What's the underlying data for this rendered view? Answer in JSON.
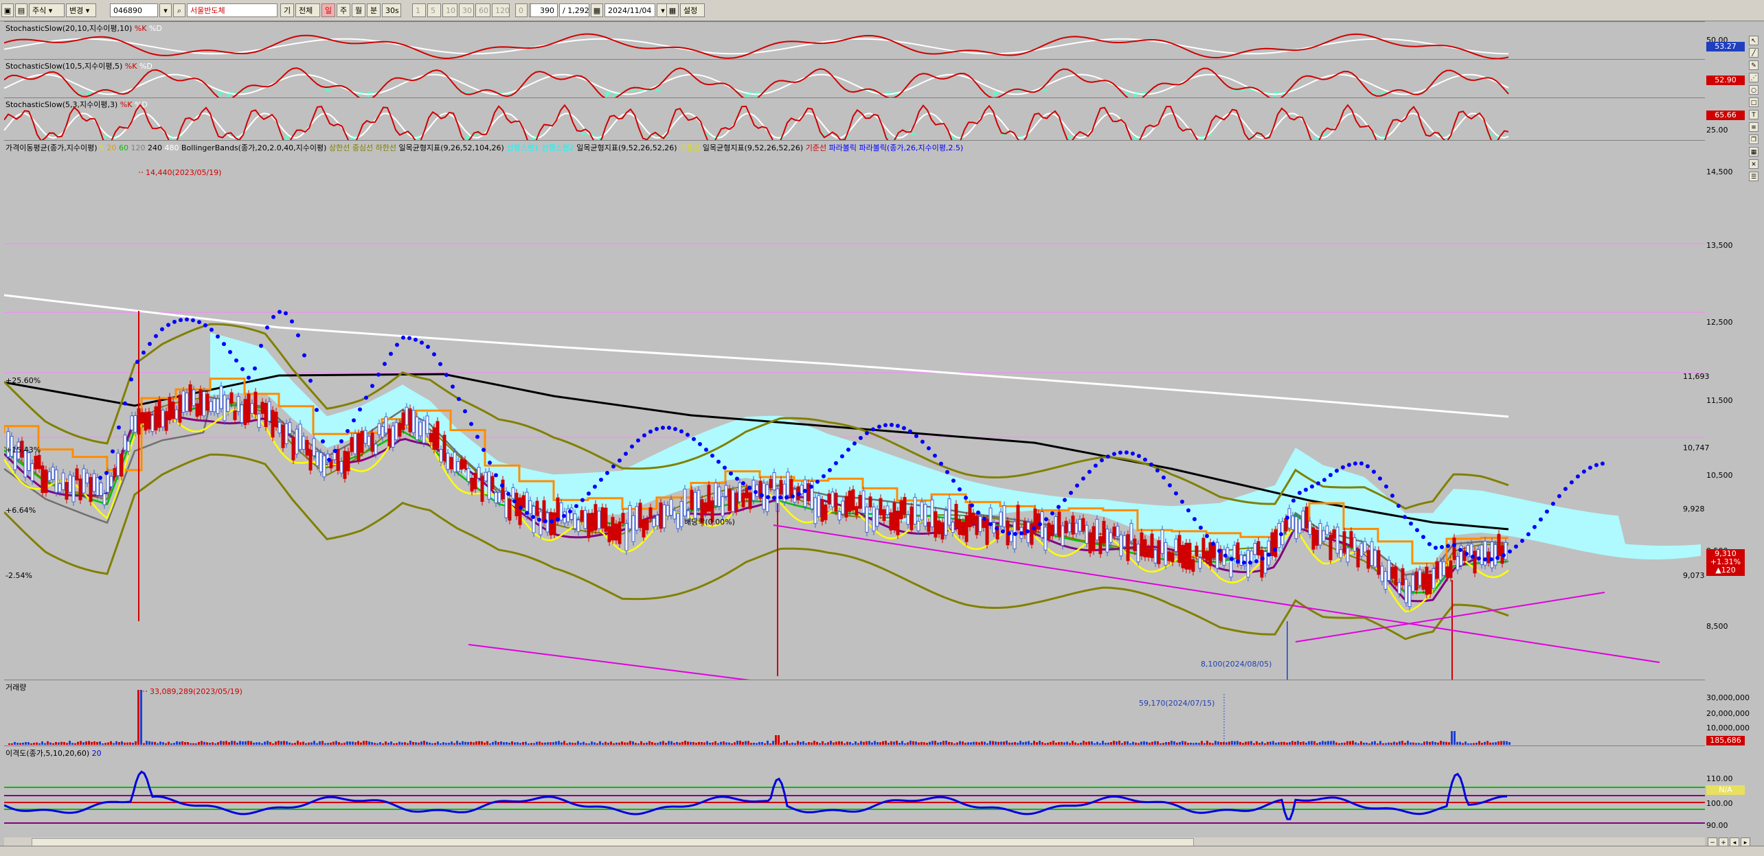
{
  "toolbar": {
    "market_type": "주식",
    "change_label": "변경",
    "code": "046890",
    "stock_name": "서울반도체",
    "period_label": "기",
    "all_label": "전체",
    "d_label": "일",
    "w_label": "주",
    "m_label": "월",
    "min_label": "분",
    "sec_label": "30s",
    "tick_buttons": [
      "1",
      "5",
      "10",
      "30",
      "60",
      "120"
    ],
    "zero_a": "0",
    "zero_b": "0",
    "count_value": "390",
    "total_value": "/ 1,292",
    "date_value": "2024/11/04",
    "settings_label": "설정"
  },
  "panels": {
    "stoch1": {
      "label": "StochasticSlow(20,10,지수이평,10)",
      "legend_k": "%K",
      "legend_d": "%D",
      "scale_top": "50.00",
      "tag": "53.27",
      "tag_color": "#1f3fbf"
    },
    "stoch2": {
      "label": "StochasticSlow(10,5,지수이평,5)",
      "legend_k": "%K",
      "legend_d": "%D",
      "tag": "52.90",
      "tag_color": "#d00000"
    },
    "stoch3": {
      "label": "StochasticSlow(5,3,지수이평,3)",
      "legend_k": "%K",
      "legend_d": "%D",
      "tag": "65.66",
      "tag_color": "#d00000",
      "scale_bottom": "25.00"
    },
    "price": {
      "legend": [
        {
          "text": "가격이동평균(종가,지수이평)",
          "color": "#000000"
        },
        {
          "text": "5",
          "color": "#e0e000"
        },
        {
          "text": "20",
          "color": "#e0a000"
        },
        {
          "text": "60",
          "color": "#00c000"
        },
        {
          "text": "120",
          "color": "#808080"
        },
        {
          "text": "240",
          "color": "#000000"
        },
        {
          "text": "480",
          "color": "#ffffff"
        },
        {
          "text": "BollingerBands(종가,20,2.0,40,지수이평)",
          "color": "#000000"
        },
        {
          "text": "상한선",
          "color": "#808000"
        },
        {
          "text": "중심선",
          "color": "#808000"
        },
        {
          "text": "하한선",
          "color": "#808000"
        },
        {
          "text": "일목균형지표(9,26,52,104,26)",
          "color": "#000000"
        },
        {
          "text": "선행스팬1",
          "color": "#00ffff"
        },
        {
          "text": "선행스팬2",
          "color": "#00ffff"
        },
        {
          "text": "일목균형지표(9,52,26,52,26)",
          "color": "#000000"
        },
        {
          "text": "기준선",
          "color": "#e0e000"
        },
        {
          "text": "일목균형지표(9,52,26,52,26)",
          "color": "#000000"
        },
        {
          "text": "기준선",
          "color": "#d00000"
        },
        {
          "text": "파라볼릭",
          "color": "#0000ff"
        },
        {
          "text": "파라볼릭(종가,26,지수이평,2.5)",
          "color": "#0000ff"
        }
      ],
      "high_annotation": "14,440(2023/05/19)",
      "low_annotation": "8,100(2024/08/05)",
      "dividend_annotation": "배당락(0.00%)",
      "pct_labels": [
        "+25.60%",
        "+15.43%",
        "+6.64%",
        "-2.54%"
      ],
      "scale_labels": [
        "14,500",
        "13,500",
        "12,500",
        "11,500",
        "10,500",
        "9,500",
        "8,500"
      ],
      "level_labels": [
        "11,693",
        "10,747",
        "9,928",
        "9,073"
      ],
      "price_tag": "9,310",
      "price_change": "+1.31%",
      "price_diff": "▲120"
    },
    "volume": {
      "label": "거래량",
      "peak_annotation": "33,089,289(2023/05/19)",
      "marker_annotation": "59,170(2024/07/15)",
      "scale_labels": [
        "30,000,000",
        "20,000,000",
        "10,000,000"
      ],
      "tag": "185,686"
    },
    "disparity": {
      "label": "이격도(종가,5,10,20,60)",
      "label_suffix": "20",
      "scale_labels": [
        "110.00",
        "100.00",
        "90.00"
      ],
      "tag": "N/A"
    }
  },
  "colors": {
    "kline": "#d00000",
    "dline": "#ffffff",
    "cloud": "#aefaff",
    "bollinger": "#808000",
    "parabolic": "#0000ff",
    "trend": "#e000e0",
    "ma240": "#000000",
    "ma480": "#ffffff",
    "disparity": "#0000e0"
  }
}
